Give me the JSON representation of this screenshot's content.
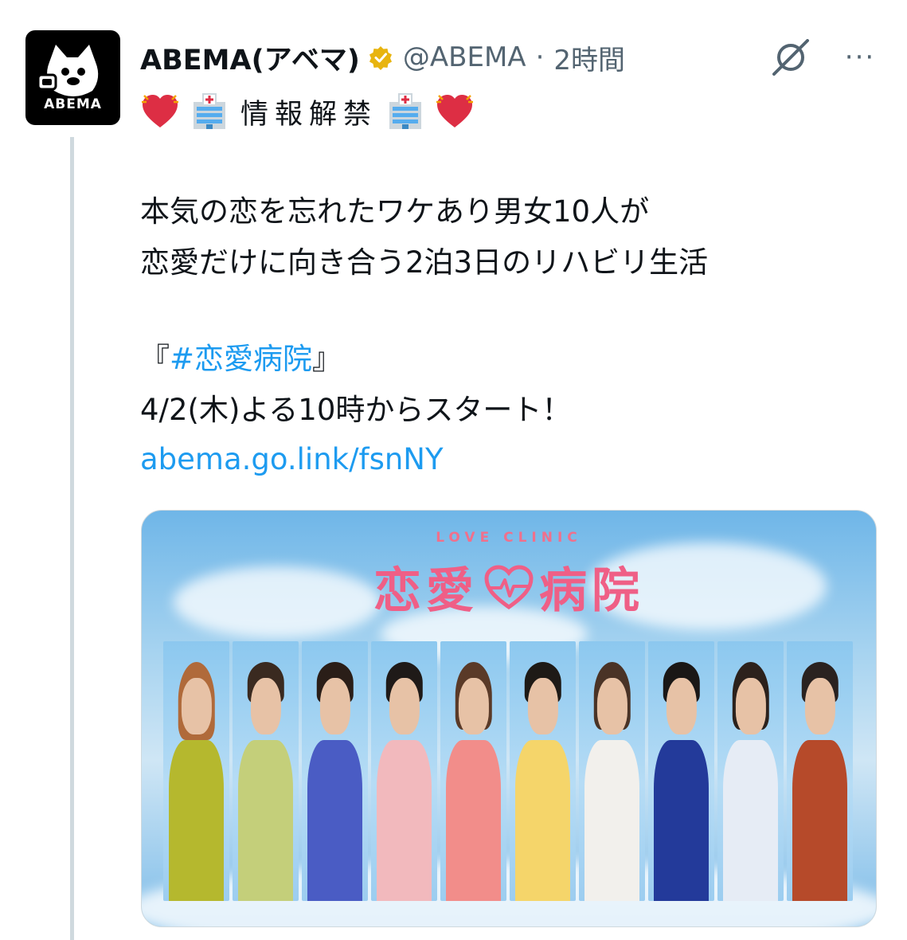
{
  "author": {
    "display_name": "ABEMA(アベマ)",
    "handle": "@ABEMA",
    "separator": "·",
    "time": "2時間",
    "avatar_text": "ABEMA",
    "verified": true
  },
  "header_actions": {
    "grok_icon": "grok-icon",
    "more_icon": "more-horizontal-icon",
    "more_label": "···"
  },
  "tweet": {
    "headline": "情報解禁",
    "emojis": [
      "heart-emoji",
      "hospital-emoji",
      "hospital-emoji",
      "heart-emoji"
    ],
    "line1": "本気の恋を忘れたワケあり男女10人が",
    "line2": "恋愛だけに向き合う2泊3日のリハビリ生活",
    "line3_open": "『",
    "hashtag": "#恋愛病院",
    "line3_close": "』",
    "line4": "4/2(木)よる10時からスタート！",
    "link": "abema.go.link/fsnNY"
  },
  "media": {
    "logo_subtitle": "LOVE CLINIC",
    "logo_title_left": "恋愛",
    "logo_title_right": "病院",
    "cast_count": 10
  },
  "colors": {
    "link": "#1d9bf0",
    "secondary_text": "#536471",
    "verified_gold": "#e8b40f",
    "logo_pink": "#ef5f86"
  }
}
